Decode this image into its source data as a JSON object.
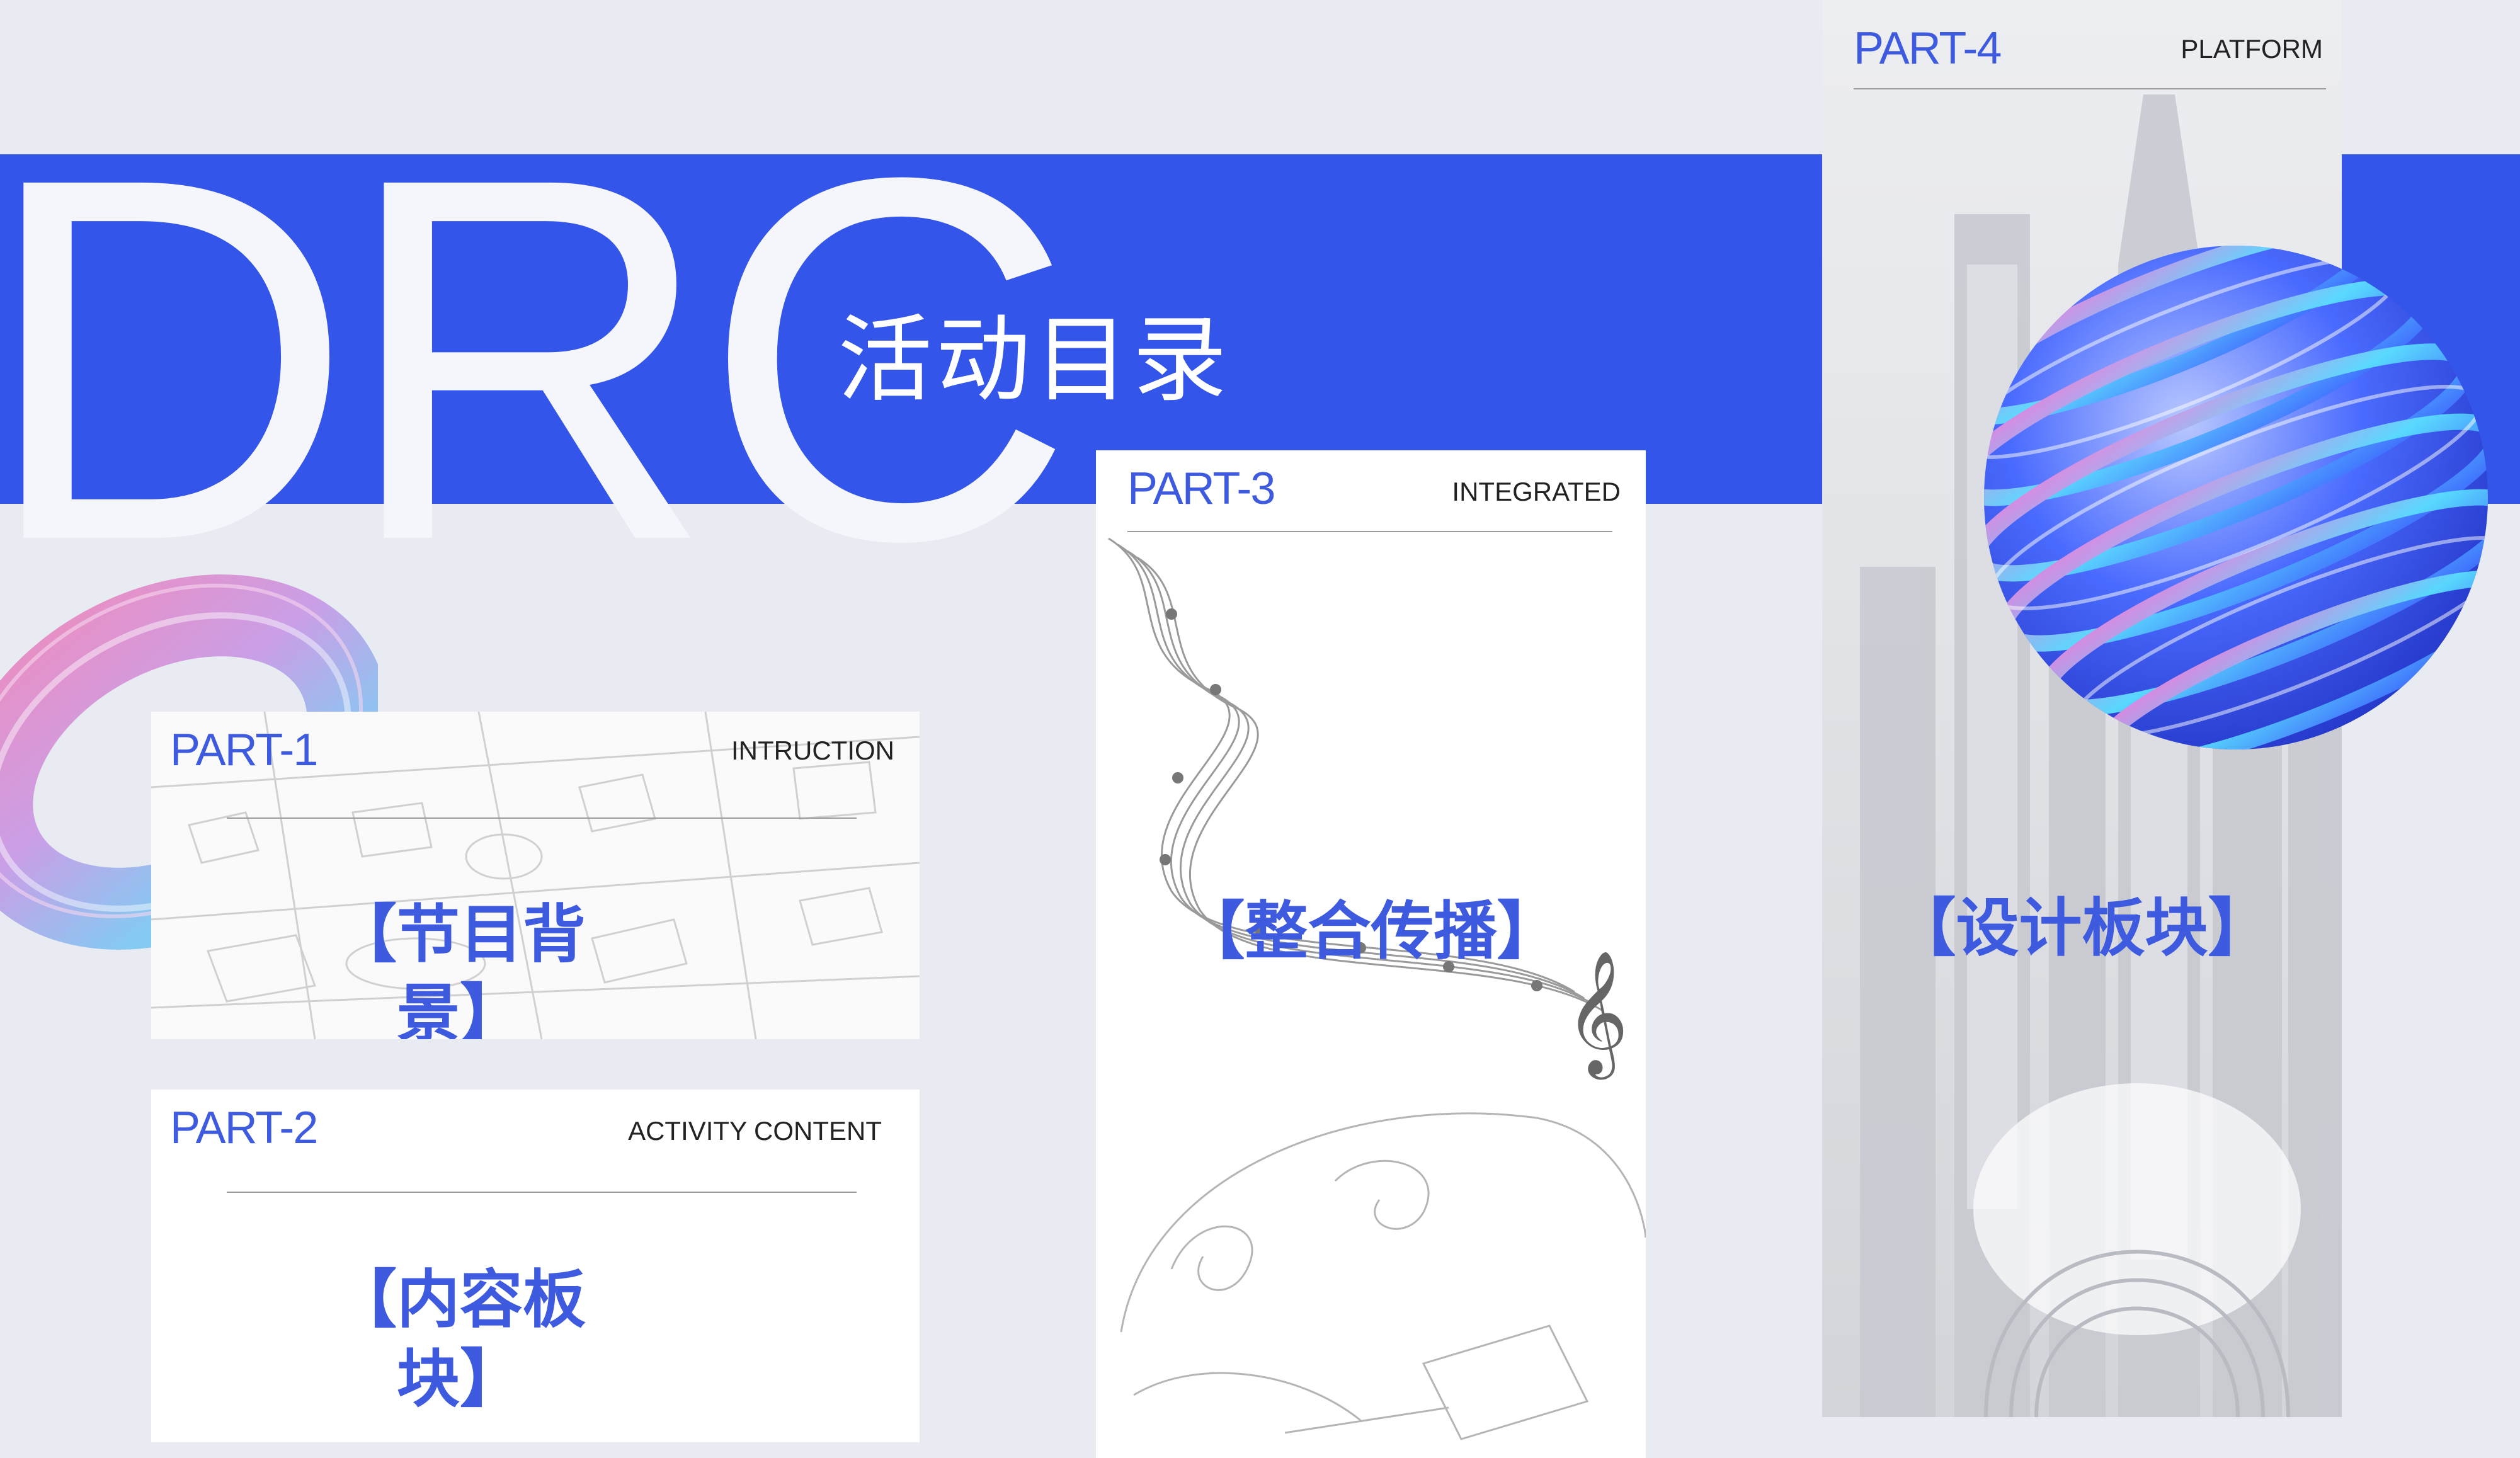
{
  "header": {
    "brand": "DRC",
    "subtitle": "活动目录"
  },
  "parts": [
    {
      "label": "PART-1",
      "subtitle": "INTRUCTION",
      "title": "【节目背景】"
    },
    {
      "label": "PART-2",
      "subtitle": "ACTIVITY CONTENT",
      "title": "【内容板块】"
    },
    {
      "label": "PART-3",
      "subtitle": "INTEGRATED",
      "title": "【整合传播】"
    },
    {
      "label": "PART-4",
      "subtitle": "PLATFORM",
      "title": "【设计板块】"
    }
  ],
  "colors": {
    "accent": "#3355EA",
    "label_blue": "#3E5BE0",
    "background": "#E8EBF1"
  },
  "decorations": {
    "torus": "holographic-torus-icon",
    "sphere": "striped-sphere-icon",
    "map": "city-map-illustration",
    "music": "music-notes-illustration",
    "city": "city-skyline-illustration"
  }
}
